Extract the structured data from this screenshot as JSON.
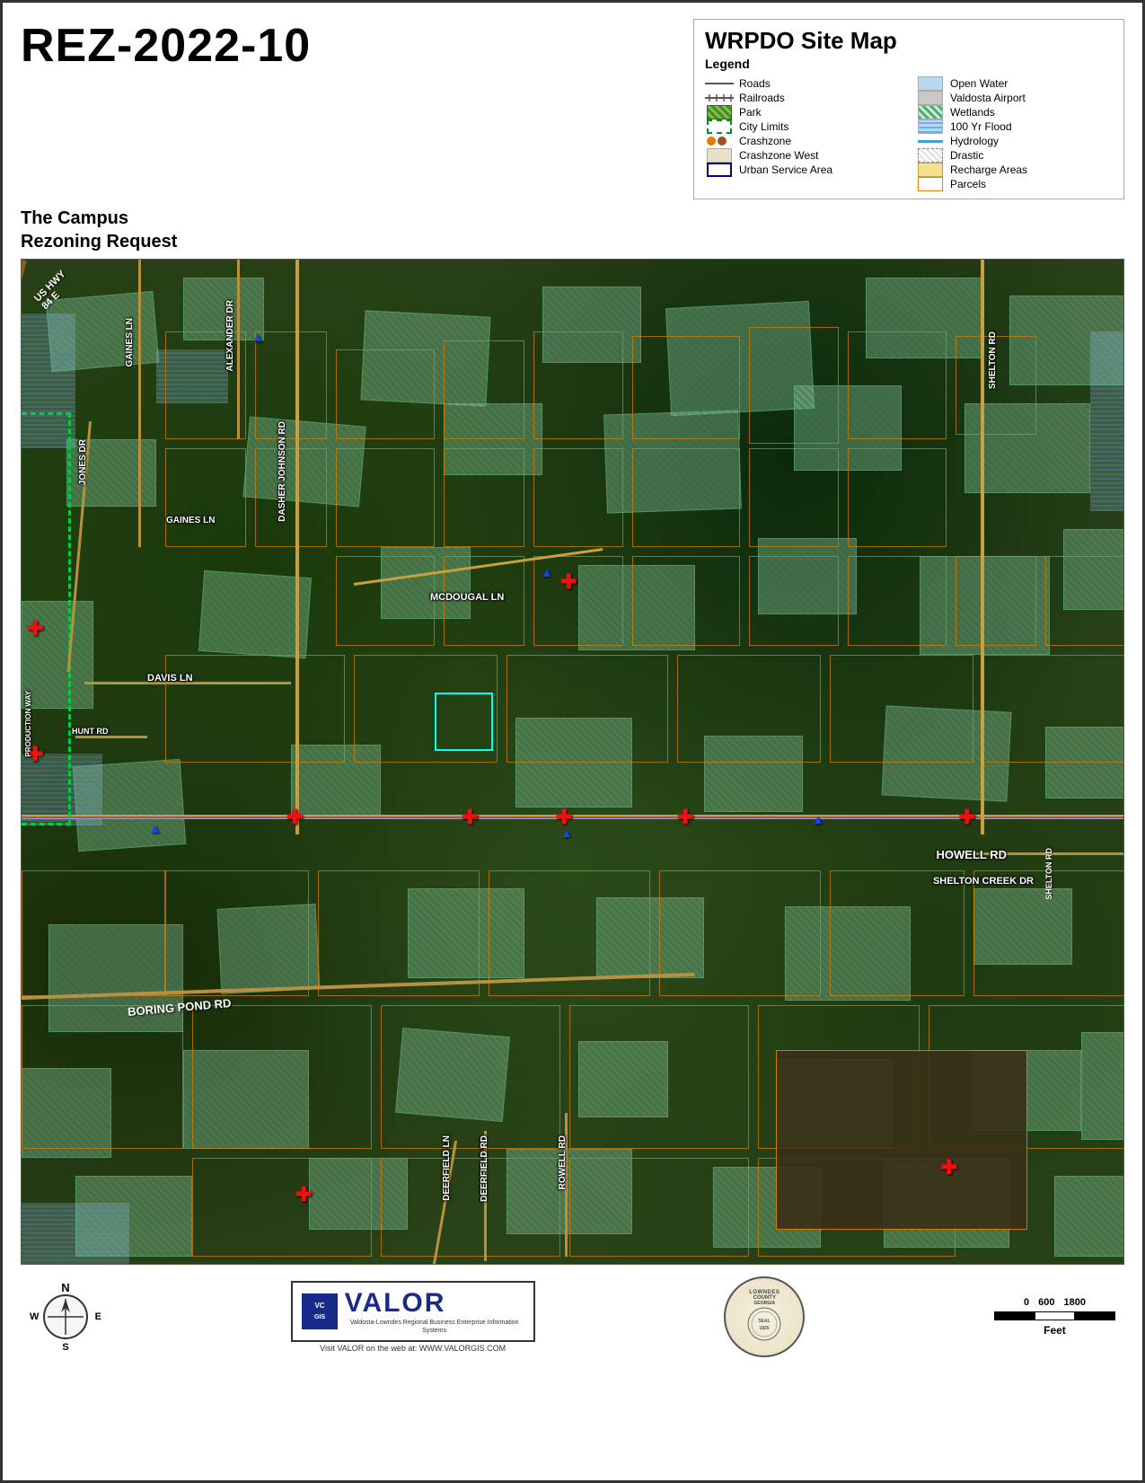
{
  "page": {
    "border_color": "#333",
    "background": "#fff"
  },
  "header": {
    "rez_title": "REZ-2022-10",
    "map_title": "WRPDO Site Map",
    "legend_label": "Legend"
  },
  "legend": {
    "items_left": [
      {
        "id": "roads",
        "symbol": "roads",
        "label": "Roads"
      },
      {
        "id": "railroads",
        "symbol": "railroads",
        "label": "Railroads"
      },
      {
        "id": "park",
        "symbol": "park",
        "label": "Park"
      },
      {
        "id": "city-limits",
        "symbol": "city-limits",
        "label": "City Limits"
      },
      {
        "id": "crashzone",
        "symbol": "crashzone",
        "label": "Crashzone"
      },
      {
        "id": "crashzone-west",
        "symbol": "crashzone-west",
        "label": "Crashzone West"
      },
      {
        "id": "urban-service",
        "symbol": "urban",
        "label": "Urban Service Area"
      }
    ],
    "items_right": [
      {
        "id": "open-water",
        "symbol": "open-water",
        "label": "Open Water"
      },
      {
        "id": "valdosta-airport",
        "symbol": "valdosta-airport",
        "label": "Valdosta Airport"
      },
      {
        "id": "wetlands",
        "symbol": "wetlands",
        "label": "Wetlands"
      },
      {
        "id": "100yr-flood",
        "symbol": "100yr",
        "label": "100 Yr Flood"
      },
      {
        "id": "hydrology",
        "symbol": "hydrology",
        "label": "Hydrology"
      },
      {
        "id": "drastic",
        "symbol": "drastic",
        "label": "Drastic"
      },
      {
        "id": "recharge-areas",
        "symbol": "recharge",
        "label": "Recharge Areas"
      },
      {
        "id": "parcels",
        "symbol": "parcels",
        "label": "Parcels"
      }
    ]
  },
  "subtitle": {
    "line1": "The Campus",
    "line2": "Rezoning Request"
  },
  "map": {
    "road_labels": [
      "US HWY 84 E",
      "GAINES LN",
      "ALEXANDER DR",
      "JONES DR",
      "DAVIS LN",
      "DASHER JOHNSON RD",
      "MCDOUGAL LN",
      "HUNT RD",
      "PRODUCTION WAY",
      "HOWELL RD",
      "SHELTON CREEK DR",
      "BORING POND RD",
      "DEERFIELD LN",
      "DEERFIELD RD",
      "ROWELL RD",
      "SHELTON RD",
      "GAINES LN"
    ]
  },
  "footer": {
    "compass": {
      "n": "N",
      "s": "S",
      "e": "E",
      "w": "W"
    },
    "logo": {
      "name": "VALOR",
      "subtitle": "Valdosta-Lowndes Regional Business Enterprise Information Systems",
      "url": "Visit VALOR on the web at: WWW.VALORGIS.COM"
    },
    "county_seal": {
      "text": "LOWNDES COUNTY GEORGIA\n1825",
      "inner_text": "SEAL"
    },
    "scale": {
      "values": "0   600   1800",
      "label": "Feet",
      "numbers": [
        "0",
        "600",
        "1800"
      ]
    }
  }
}
